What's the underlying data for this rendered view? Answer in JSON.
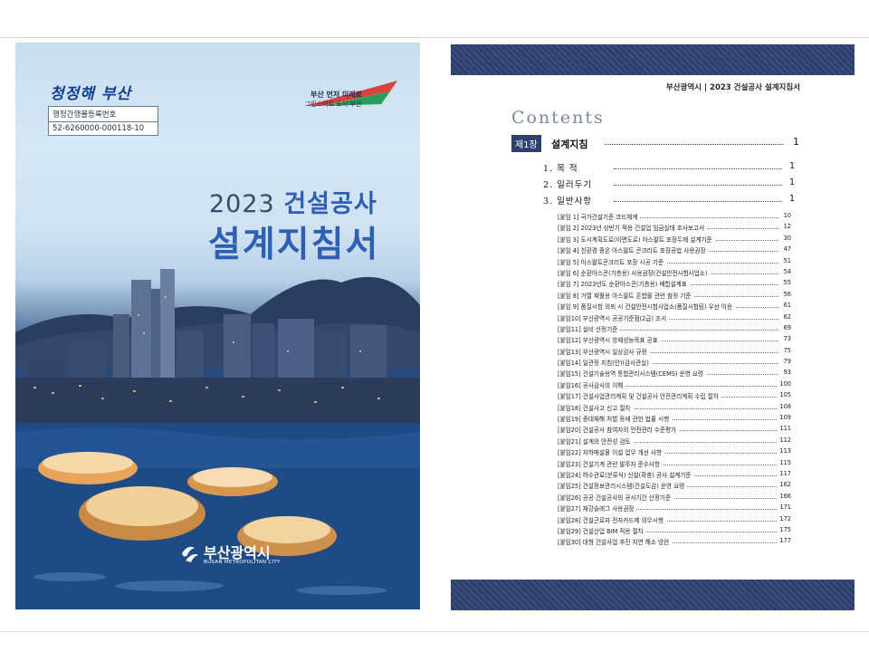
{
  "cover": {
    "slogan_logo": "청정해 부산",
    "registration_label": "행정간행물등록번호",
    "registration_number": "52-6260000-000118-10",
    "brand_tag_line1": "부산 먼저 미래로",
    "brand_tag_line2": "그린스마트 도시 부산",
    "year": "2023",
    "title_highlight": "건설공사",
    "main_title": "설계지침서",
    "city_name": "부산광역시",
    "city_name_en": "BUSAN METROPOLITAN CITY",
    "colors": {
      "title_blue": "#2f5fb2",
      "sky": "#cfe2f1",
      "night": "#1f3b6c"
    }
  },
  "contents": {
    "header": "부산광역시 | 2023 건설공사 설계지침서",
    "title": "Contents",
    "chapter": {
      "tag": "제1장",
      "label": "설계지침",
      "page": "1"
    },
    "sections": [
      {
        "label": "1. 목   적",
        "page": "1"
      },
      {
        "label": "2. 일러두기",
        "page": "1"
      },
      {
        "label": "3. 일반사항",
        "page": "1"
      }
    ],
    "items": [
      {
        "label": "[붙임 1] 국가건설기준 코드체계",
        "page": "10"
      },
      {
        "label": "[붙임 2] 2023년 상반기 적용 건설업 임금실태 조사보고서",
        "page": "12"
      },
      {
        "label": "[붙임 3] 도시계획도로(이면도로) 아스팔트 포장두께 설계기준",
        "page": "30"
      },
      {
        "label": "[붙임 4] 친환경 중온 아스팔트 콘크리트 포장공법 사용권장",
        "page": "47"
      },
      {
        "label": "[붙임 5] 아스팔트콘크리트 포장 시공 기준",
        "page": "51"
      },
      {
        "label": "[붙임 6] 순환아스콘(기층용) 사용권장(건설안전시험사업소)",
        "page": "54"
      },
      {
        "label": "[붙임 7] 2023년도 순환아스콘(기층용) 배합설계표",
        "page": "55"
      },
      {
        "label": "[붙임 8] 가열 재활용 아스팔트 혼합물 관련 참정 기준",
        "page": "56"
      },
      {
        "label": "[붙임 9] 품질시험 의뢰 시 건설안전시험사업소(품질시험팀) 우선 이용",
        "page": "61"
      },
      {
        "label": "[붙임10] 부산광역시 공공기준점(2급) 조서",
        "page": "62"
      },
      {
        "label": "[붙임11] 실비 산정기준",
        "page": "69"
      },
      {
        "label": "[붙임12] 부산광역시 방재성능목표 공표",
        "page": "73"
      },
      {
        "label": "[붙임13] 부산광역시 일상감사 규정",
        "page": "75"
      },
      {
        "label": "[붙임14] 일관정 지침(안)(감사관실)",
        "page": "79"
      },
      {
        "label": "[붙임15] 건설기술용역 통합관리시스템(CEMS) 운영 요령",
        "page": "93"
      },
      {
        "label": "[붙임16] 공사감사의 이해",
        "page": "100"
      },
      {
        "label": "[붙임17] 건설사업관리계획 및 건설공사 안전관리계획 수립 절차",
        "page": "105"
      },
      {
        "label": "[붙임18] 건설사고 신고 절차",
        "page": "108"
      },
      {
        "label": "[붙임19] 중대재해 처벌 등에 관한 법률 시행",
        "page": "109"
      },
      {
        "label": "[붙임20] 건설공사 참여자의 안전관리 수준평가",
        "page": "111"
      },
      {
        "label": "[붙임21] 설계의 안전성 검토",
        "page": "112"
      },
      {
        "label": "[붙임22] 지하매설물 이설 업무 개선 사항",
        "page": "113"
      },
      {
        "label": "[붙임23] 건설기계 관련 발주자 준수사항",
        "page": "115"
      },
      {
        "label": "[붙임24] 하수관로(분류식) 신설(확충) 공사 설계기준",
        "page": "117"
      },
      {
        "label": "[붙임25] 건설정보관리시스템(건설도감) 운영 요령",
        "page": "162"
      },
      {
        "label": "[붙임26] 공공 건설공사의 공사기간 산정기준",
        "page": "166"
      },
      {
        "label": "[붙임27] 재강슬래그 사용권장",
        "page": "171"
      },
      {
        "label": "[붙임28] 건설근로자 전자카드제 의무시행",
        "page": "172"
      },
      {
        "label": "[붙임29] 건설산업 BIM 적용 절차",
        "page": "175"
      },
      {
        "label": "[붙임30] 대형 건설사업 추진 지연 해소 방안",
        "page": "177"
      }
    ]
  }
}
